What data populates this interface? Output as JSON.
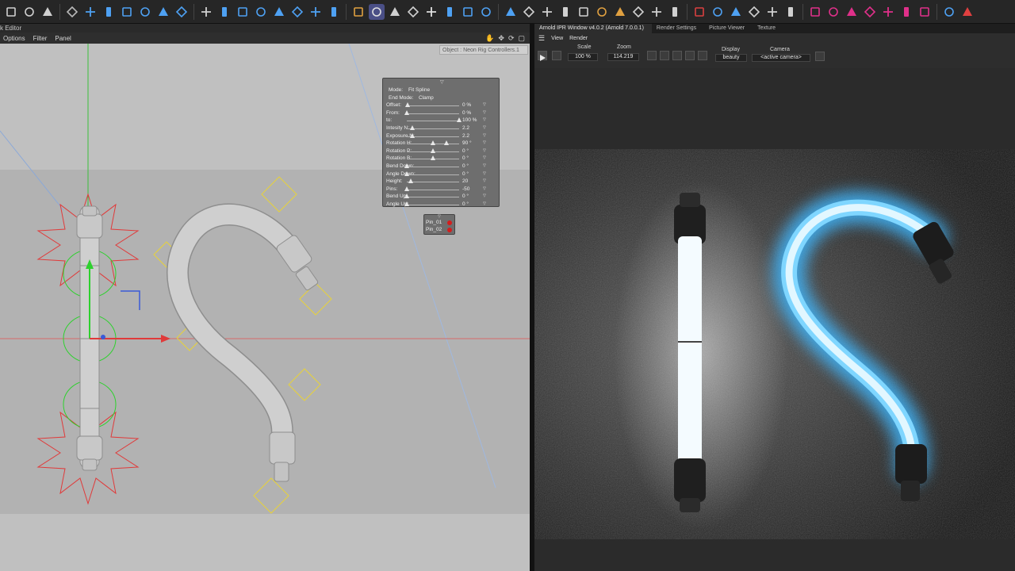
{
  "toolbar": {
    "tools": [
      {
        "name": "undo-icon",
        "color": "#d0d0d0",
        "active": false
      },
      {
        "name": "import-icon",
        "color": "#d0d0d0",
        "active": false
      },
      {
        "name": "render-settings-icon",
        "color": "#d0d0d0",
        "active": false
      },
      {
        "name": "cube-icon",
        "color": "#b8b8b8",
        "active": false
      },
      {
        "name": "object-icon",
        "color": "#4ea1f3",
        "active": false
      },
      {
        "name": "trash-icon",
        "color": "#4ea1f3",
        "active": false
      },
      {
        "name": "move-icon",
        "color": "#4ea1f3",
        "active": false
      },
      {
        "name": "scale-icon",
        "color": "#4ea1f3",
        "active": false
      },
      {
        "name": "rotate-icon",
        "color": "#4ea1f3",
        "active": false
      },
      {
        "name": "link-icon",
        "color": "#4ea1f3",
        "active": false
      },
      {
        "name": "magnet-icon",
        "color": "#d0d0d0",
        "active": false
      },
      {
        "name": "spline-icon",
        "color": "#4ea1f3",
        "active": false
      },
      {
        "name": "spline-pen-icon",
        "color": "#4ea1f3",
        "active": false
      },
      {
        "name": "knife-icon",
        "color": "#4ea1f3",
        "active": false
      },
      {
        "name": "array-icon",
        "color": "#4ea1f3",
        "active": false
      },
      {
        "name": "grid-icon",
        "color": "#4ea1f3",
        "active": false
      },
      {
        "name": "deform-icon",
        "color": "#4ea1f3",
        "active": false
      },
      {
        "name": "camera-icon",
        "color": "#4ea1f3",
        "active": false
      },
      {
        "name": "brush-icon",
        "color": "#e0a040",
        "active": false
      },
      {
        "name": "snap-grid-icon",
        "color": "#e0e0e0",
        "active": true
      },
      {
        "name": "workplane-icon",
        "color": "#d0d0d0",
        "active": false
      },
      {
        "name": "viewport-icon",
        "color": "#d0d0d0",
        "active": false
      },
      {
        "name": "crop-icon",
        "color": "#e0e0e0",
        "active": false
      },
      {
        "name": "paint-icon",
        "color": "#4ea1f3",
        "active": false
      },
      {
        "name": "eraser-icon",
        "color": "#4ea1f3",
        "active": false
      },
      {
        "name": "sculpt-icon",
        "color": "#4ea1f3",
        "active": false
      },
      {
        "name": "sphere-icon",
        "color": "#4ea1f3",
        "active": false
      },
      {
        "name": "shader-ball-icon",
        "color": "#d0d0d0",
        "active": false
      },
      {
        "name": "material-icon",
        "color": "#d0d0d0",
        "active": false
      },
      {
        "name": "light-icon",
        "color": "#d0d0d0",
        "active": false
      },
      {
        "name": "texture-icon",
        "color": "#d0d0d0",
        "active": false
      },
      {
        "name": "checker-icon",
        "color": "#e0a040",
        "active": false
      },
      {
        "name": "cylinder-icon",
        "color": "#e0a040",
        "active": false
      },
      {
        "name": "emitter-icon",
        "color": "#d0d0d0",
        "active": false
      },
      {
        "name": "sky-icon",
        "color": "#d0d0d0",
        "active": false
      },
      {
        "name": "arnold-sphere-icon",
        "color": "#d0d0d0",
        "active": false
      },
      {
        "name": "arnold-red-icon",
        "color": "#d94040",
        "active": false
      },
      {
        "name": "paint-brush-icon",
        "color": "#4ea1f3",
        "active": false
      },
      {
        "name": "pen-icon",
        "color": "#4ea1f3",
        "active": false
      },
      {
        "name": "shapes-icon",
        "color": "#d0d0d0",
        "active": false
      },
      {
        "name": "drop-icon",
        "color": "#d0d0d0",
        "active": false
      },
      {
        "name": "pyramid-icon",
        "color": "#d0d0d0",
        "active": false
      },
      {
        "name": "half-circle-icon",
        "color": "#e0308a",
        "active": false
      },
      {
        "name": "card-icon",
        "color": "#e0308a",
        "active": false
      },
      {
        "name": "bowtie-icon",
        "color": "#e0308a",
        "active": false
      },
      {
        "name": "split-circle-icon",
        "color": "#e0308a",
        "active": false
      },
      {
        "name": "pill-icon",
        "color": "#e0308a",
        "active": false
      },
      {
        "name": "cloner-icon",
        "color": "#e0308a",
        "active": false
      },
      {
        "name": "effector-icon",
        "color": "#e0308a",
        "active": false
      },
      {
        "name": "play-icon",
        "color": "#4ea1f3",
        "active": false
      },
      {
        "name": "record-icon",
        "color": "#e04040",
        "active": false
      }
    ]
  },
  "left": {
    "title": "k Editor",
    "menu": [
      "Options",
      "Filter",
      "Panel"
    ],
    "object_label": "Object : Neon Rig Controllers.1"
  },
  "rig": {
    "rows": [
      {
        "label": "Mode:",
        "value": "Fit Spline",
        "type": "text"
      },
      {
        "label": "End Mode:",
        "value": "Clamp",
        "type": "text"
      },
      {
        "label": "Offset:",
        "value": "0 %",
        "type": "slider",
        "level": 0.02
      },
      {
        "label": "From:",
        "value": "0 %",
        "type": "slider",
        "level": 0.0
      },
      {
        "label": "to:",
        "value": "100 %",
        "type": "slider",
        "level": 1.0
      },
      {
        "label": "Intesity N:",
        "value": "2.2",
        "type": "slider",
        "level": 0.11
      },
      {
        "label": "Exposure N:",
        "value": "2.2",
        "type": "slider",
        "level": 0.11
      },
      {
        "label": "Rotation H:",
        "value": "90 °",
        "type": "slider2",
        "level": 0.5
      },
      {
        "label": "Rotation P:",
        "value": "0 °",
        "type": "slider",
        "level": 0.5
      },
      {
        "label": "Rotation B:",
        "value": "0 °",
        "type": "slider",
        "level": 0.5
      },
      {
        "label": "Bend Down:",
        "value": "0 °",
        "type": "slider",
        "level": 0.0
      },
      {
        "label": "Angle Down:",
        "value": "0 °",
        "type": "slider",
        "level": 0.0
      },
      {
        "label": "Height:",
        "value": "20",
        "type": "slider",
        "level": 0.08
      },
      {
        "label": "Pins:",
        "value": "-50",
        "type": "slider",
        "level": 0.0
      },
      {
        "label": "Bend Up:",
        "value": "0 °",
        "type": "slider",
        "level": 0.0
      },
      {
        "label": "Angle Up:",
        "value": "0 °",
        "type": "slider",
        "level": 0.0
      }
    ],
    "pins": [
      "Pin_01",
      "Pin_02"
    ]
  },
  "ipr": {
    "tabs": [
      "Arnold IPR Window v4.0.2 (Arnold 7.0.0.1)",
      "Render Settings",
      "Picture Viewer",
      "Texture"
    ],
    "menu": [
      "View",
      "Render"
    ],
    "scale_label": "Scale",
    "scale_value": "100 %",
    "zoom_label": "Zoom",
    "zoom_value": "114.219",
    "display_label": "Display",
    "display_value": "beauty",
    "camera_label": "Camera",
    "camera_value": "<active camera>"
  },
  "colors": {
    "neon_blue": "#3fb8ff",
    "neon_white": "#f4fbff",
    "active_tool": "#4a4f86",
    "gizmo_red": "#e03a3a",
    "gizmo_green": "#2ed12e",
    "pin_red": "#d51d1d"
  }
}
